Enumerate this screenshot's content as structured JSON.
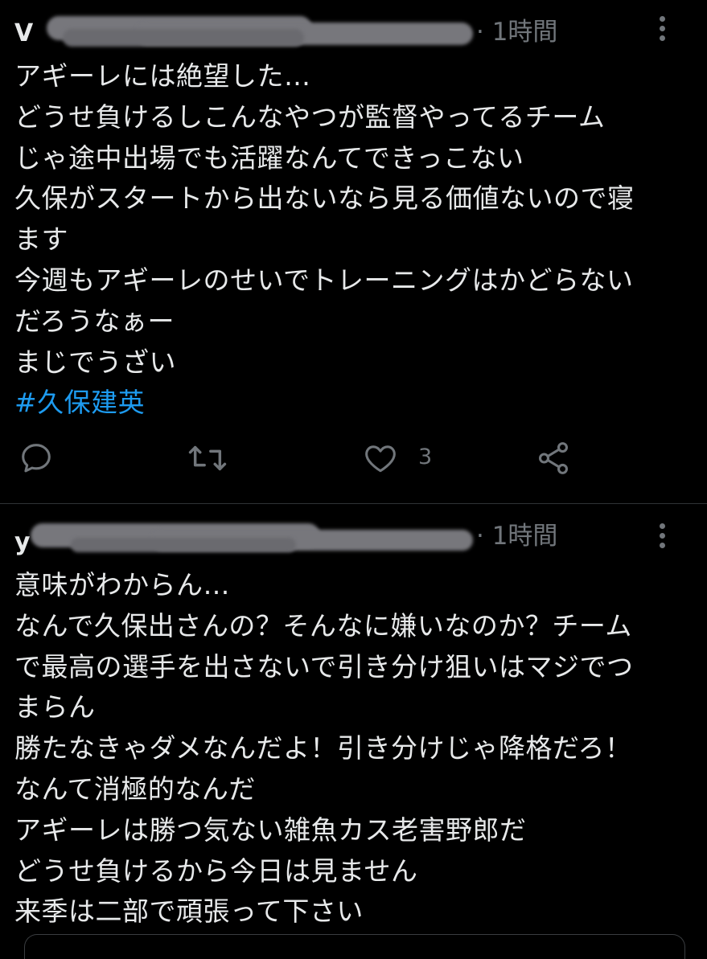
{
  "tweets": [
    {
      "username": "V",
      "meta": "· 1時間",
      "lines": [
        "アギーレには絶望した…",
        "どうせ負けるしこんなやつが監督やってるチーム",
        "じゃ途中出場でも活躍なんてできっこない",
        "久保がスタートから出ないなら見る価値ないので寝",
        "ます",
        "今週もアギーレのせいでトレーニングはかどらない",
        "だろうなぁー",
        "まじでうざい"
      ],
      "hashtag": "#久保建英",
      "actions": {
        "reply_icon": "reply-icon",
        "retweet_icon": "retweet-icon",
        "like_icon": "heart-icon",
        "like_count": "3",
        "share_icon": "share-icon"
      }
    },
    {
      "username": "y",
      "meta": "· 1時間",
      "lines": [
        "意味がわからん…",
        "なんで久保出さんの？そんなに嫌いなのか？チーム",
        "で最高の選手を出さないで引き分け狙いはマジでつ",
        "まらん",
        "勝たなきゃダメなんだよ！引き分けじゃ降格だろ！",
        "なんて消極的なんだ",
        "アギーレは勝つ気ない雑魚カス老害野郎だ",
        "どうせ負けるから今日は見ません",
        "来季は二部で頑張って下さい"
      ]
    }
  ],
  "colors": {
    "background": "#000000",
    "text": "#e7e9ea",
    "secondary": "#71767b",
    "link": "#1d9bf0"
  }
}
